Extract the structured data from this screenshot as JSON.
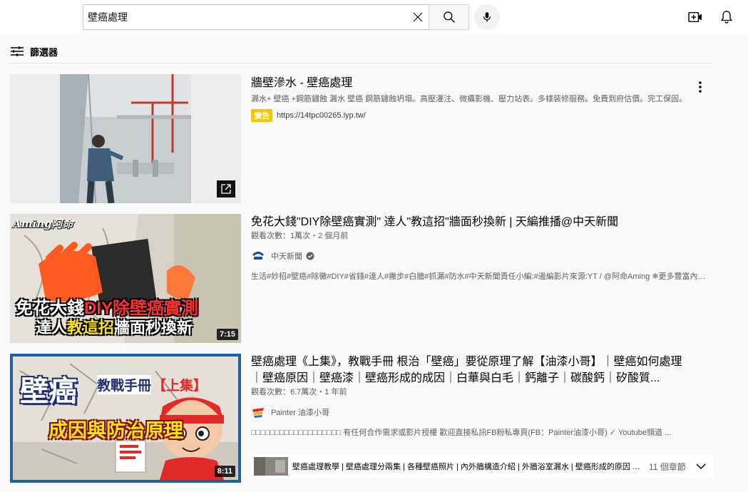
{
  "header": {
    "search_value": "壁癌處理",
    "icons": {
      "clear": "close-icon",
      "search": "search-icon",
      "mic": "microphone-icon",
      "create": "video-add-icon",
      "notifications": "bell-icon"
    }
  },
  "filters": {
    "label": "篩選器",
    "icon": "sliders-icon"
  },
  "results": [
    {
      "kind": "ad",
      "title": "牆壁滲水 - 壁癌處理",
      "description": "漏水+ 壁癌 +鋼筋鏽蝕 漏水 壁癌 鋼筋鏽蝕坍塌。高壓灌注、微攝影機、壓力站表。多樣裝修服務。免費到府估價。完工保固。",
      "ad_badge": "廣告",
      "url": "https://14tpc00265.iyp.tw/"
    },
    {
      "kind": "video",
      "title": "免花大錢\"DIY除壁癌實測\" 達人\"教這招\"牆面秒換新 | 天編推播@中天新聞",
      "meta": "觀看次數：1萬次・2 個月前",
      "channel": "中天新聞",
      "verified": true,
      "description": "生活#妙招#壁癌#除黴#DIY#省錢#達人#撇步#白牆#抓漏#防水#中天新聞責任小編:#邊編影片來源:YT / @阿命Aming ❄更多豐富內容 ...",
      "duration": "7:15",
      "thumb_text": {
        "logo": "Aming阿命",
        "line1": "免花大錢",
        "line1_accent": "DIY除壁癌實測",
        "line2_a": "達人",
        "line2_accent": "教這招",
        "line2_b": "牆面秒換新"
      }
    },
    {
      "kind": "video",
      "title": "壁癌處理《上集》，教戰手冊 根治「壁癌」要從原理了解【油漆小哥】｜壁癌如何處理｜壁癌原因｜壁癌漆｜壁癌形成的成因｜白華與白毛｜鈣離子｜碳酸鈣｜矽酸質...",
      "meta": "觀看次數：6.7萬次・1 年前",
      "channel": "Painter 油漆小哥",
      "description": "□□□□□□□□□□□□□□□□□□□ 有任何合作需求或影片授權 歡迎直接私訊FB粉私專頁(FB：Painter油漆小哥) ✓ Youtube頻道 ...",
      "duration": "8:11",
      "thumb_text": {
        "big": "壁癌",
        "sub": "教戰手冊",
        "tag": "【上集】",
        "bottom": "成因與防治原理",
        "brand": "Painter 油漆小哥"
      },
      "chapters": {
        "text": "壁癌處理教學 | 壁癌處理分兩集 | 各種壁癌照片 | 內外牆構造介紹 | 外牆浴室漏水 | 壁癌形成的原因 | 壁...",
        "count": "11 個章節"
      }
    }
  ],
  "colors": {
    "ad_badge": "#f7c400",
    "text_primary": "#030303",
    "text_secondary": "#606060",
    "header_bg": "#ffffff",
    "page_bg": "#f9f9f9"
  }
}
